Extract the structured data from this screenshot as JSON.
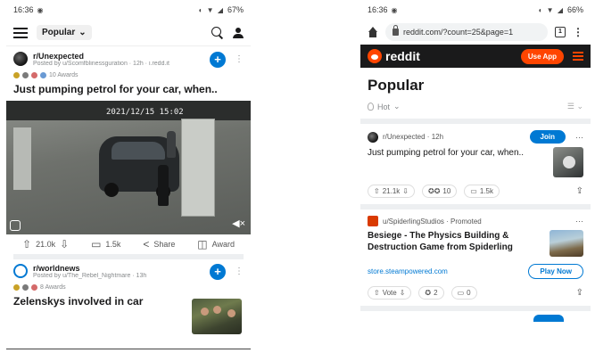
{
  "left": {
    "status": {
      "time": "16:36",
      "battery": "67%"
    },
    "header": {
      "feed_label": "Popular",
      "dropdown_glyph": "⌄"
    },
    "posts": [
      {
        "subreddit": "r/Unexpected",
        "posted_by": "Posted by u/Scomfblinessguration · 12h · i.redd.it",
        "awards": "10 Awards",
        "title": "Just pumping petrol for your car, when..",
        "video_timestamp": "2021/12/15 15:02",
        "upvotes": "21.0k",
        "comments": "1.5k",
        "share_label": "Share",
        "award_label": "Award"
      },
      {
        "subreddit": "r/worldnews",
        "posted_by": "Posted by u/The_Rebel_Nightmare · 13h",
        "awards": "8 Awards",
        "title": "Zelenskys involved in car"
      }
    ]
  },
  "right": {
    "status": {
      "time": "16:36",
      "battery": "66%"
    },
    "browser": {
      "url": "reddit.com/?count=25&page=1",
      "tab_count": "1"
    },
    "reddit_bar": {
      "brand": "reddit",
      "use_app": "Use App"
    },
    "page_title": "Popular",
    "sort": {
      "label": "Hot"
    },
    "cards": [
      {
        "meta": "r/Unexpected · 12h",
        "join": "Join",
        "title": "Just pumping petrol for your car, when..",
        "votes": "21.1k",
        "awards_count": "10",
        "comments": "1.5k"
      },
      {
        "meta": "u/SpiderlingStudios · Promoted",
        "title": "Besiege - The Physics Building & Destruction Game from Spiderling",
        "link": "store.steampowered.com",
        "cta": "Play Now",
        "vote_label": "Vote",
        "awards_count": "2",
        "comments": "0"
      }
    ]
  },
  "colors": {
    "reddit_orange": "#ff4500",
    "reddit_blue": "#0079d3",
    "reddit_dark": "#1a1a1b"
  },
  "icons": [
    "menu-icon",
    "search-icon",
    "user-icon",
    "home-icon",
    "lock-icon",
    "tabs-icon",
    "more-icon",
    "upvote-icon",
    "downvote-icon",
    "comment-icon",
    "share-icon",
    "award-icon",
    "mute-icon",
    "flame-icon"
  ]
}
